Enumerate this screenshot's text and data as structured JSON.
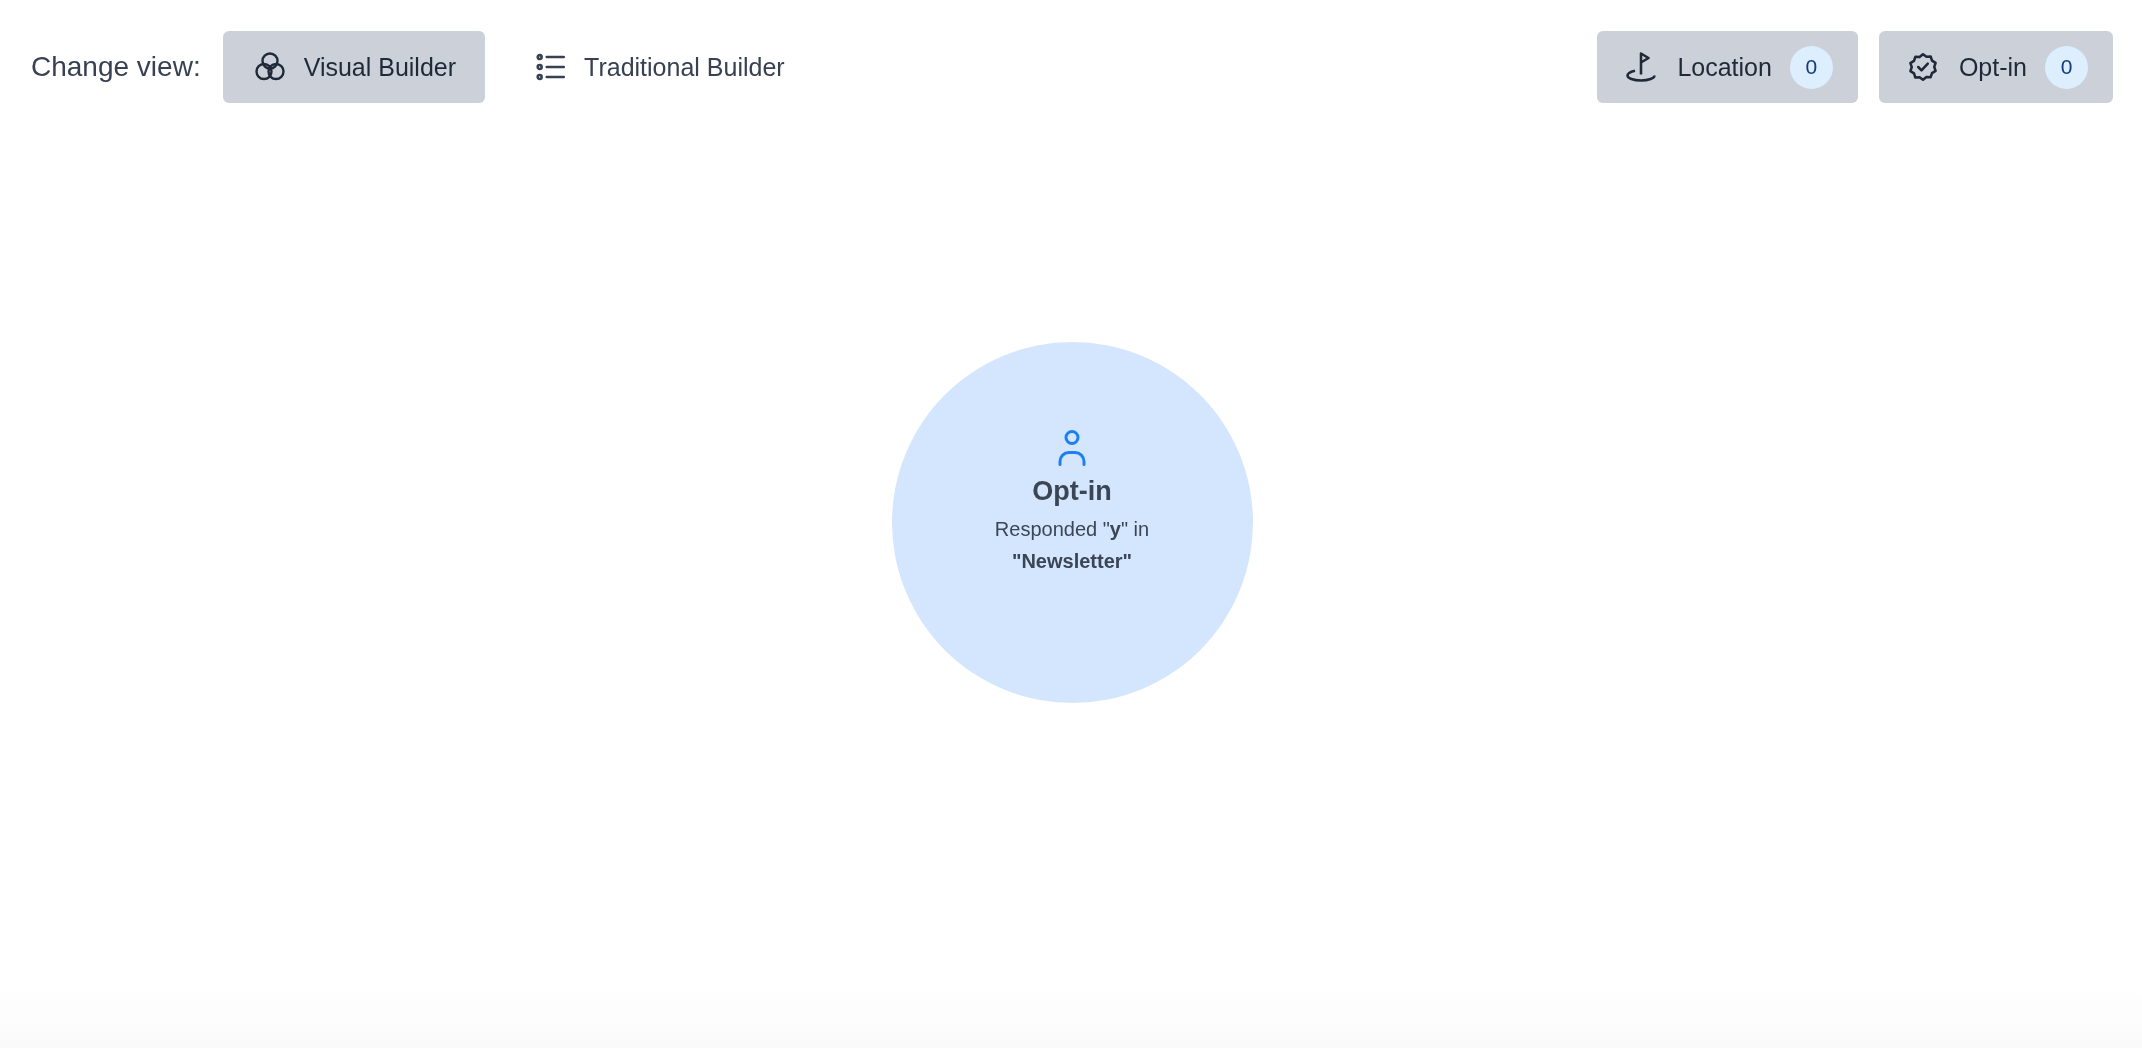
{
  "view_switcher": {
    "label": "Change view:",
    "views": [
      {
        "label": "Visual Builder",
        "kind": "circles",
        "selected": true
      },
      {
        "label": "Traditional Builder",
        "kind": "list",
        "selected": false
      }
    ]
  },
  "filters": [
    {
      "label": "Location",
      "kind": "location",
      "count": "0"
    },
    {
      "label": "Opt-in",
      "kind": "badge",
      "count": "0"
    }
  ],
  "canvas": {
    "nodes": [
      {
        "kind": "person",
        "title": "Opt-in",
        "description": "Responded \"**y**\" in **\"Newsletter\"**"
      }
    ]
  }
}
